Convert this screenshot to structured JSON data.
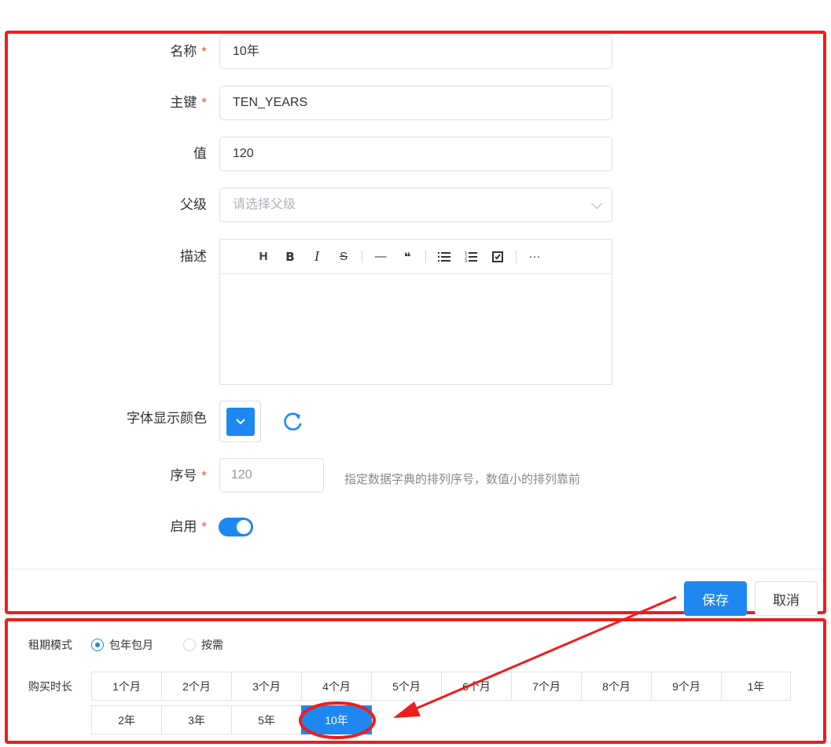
{
  "form": {
    "name": {
      "label": "名称",
      "required": "*",
      "value": "10年"
    },
    "key": {
      "label": "主键",
      "required": "*",
      "value": "TEN_YEARS"
    },
    "value": {
      "label": "值",
      "value": "120"
    },
    "parent": {
      "label": "父级",
      "placeholder": "请选择父级"
    },
    "description": {
      "label": "描述",
      "toolbar": [
        "H",
        "B",
        "I",
        "S",
        "—",
        "❝",
        "list",
        "ordered-list",
        "checklist",
        "···"
      ]
    },
    "font_color": {
      "label": "字体显示颜色",
      "color": "#1e88f0"
    },
    "sort": {
      "label": "序号",
      "required": "*",
      "placeholder": "120",
      "hint": "指定数据字典的排列序号，数值小的排列靠前"
    },
    "enabled": {
      "label": "启用",
      "required": "*",
      "on": true
    }
  },
  "footer": {
    "save_label": "保存",
    "cancel_label": "取消"
  },
  "preview": {
    "mode_label": "租期模式",
    "modes": [
      {
        "label": "包年包月",
        "selected": true
      },
      {
        "label": "按需",
        "selected": false
      }
    ],
    "duration_label": "购买时长",
    "row1": [
      "1个月",
      "2个月",
      "3个月",
      "4个月",
      "5个月",
      "6个月",
      "7个月",
      "8个月",
      "9个月",
      "1年"
    ],
    "row2": [
      "2年",
      "3年",
      "5年",
      "10年"
    ],
    "selected": "10年"
  },
  "colors": {
    "accent": "#1e88f0",
    "annotation": "#ee1d1d"
  }
}
